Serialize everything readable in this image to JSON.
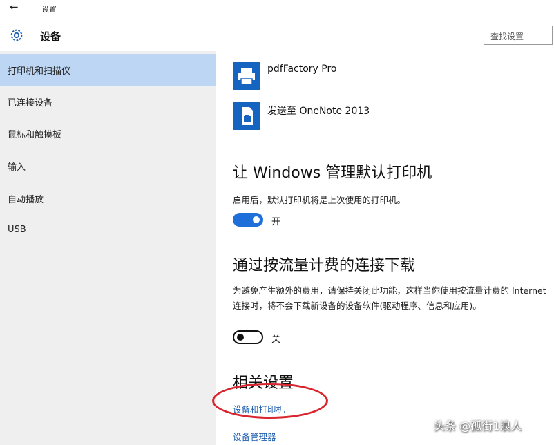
{
  "window": {
    "back_glyph": "←",
    "app_title": "设置"
  },
  "header": {
    "icon": "gear-icon",
    "title": "设备",
    "search_placeholder": "查找设置"
  },
  "sidebar": {
    "items": [
      {
        "label": "打印机和扫描仪",
        "active": true
      },
      {
        "label": "已连接设备"
      },
      {
        "label": "鼠标和触摸板"
      },
      {
        "label": "输入"
      },
      {
        "label": "自动播放"
      },
      {
        "label": "USB"
      }
    ]
  },
  "main": {
    "printers": [
      {
        "name": "pdfFactory Pro",
        "icon": "printer-icon"
      },
      {
        "name": "发送至 OneNote 2013",
        "icon": "document-printer-icon"
      }
    ],
    "default_printer": {
      "title": "让 Windows 管理默认打印机",
      "desc": "启用后，默认打印机将是上次使用的打印机。",
      "toggle_state": "on",
      "toggle_label": "开"
    },
    "metered": {
      "title": "通过按流量计费的连接下载",
      "desc": "为避免产生额外的费用，请保持关闭此功能，这样当你使用按流量计费的 Internet 连接时，将不会下载新设备的设备软件(驱动程序、信息和应用)。",
      "toggle_state": "off",
      "toggle_label": "关"
    },
    "related": {
      "title": "相关设置",
      "links": [
        "设备和打印机",
        "设备管理器"
      ]
    }
  },
  "colors": {
    "accent": "#1e6fd9",
    "selected": "#bcd6f3",
    "highlight": "#d9262e"
  },
  "watermark": "头条 @孤街1浪人"
}
